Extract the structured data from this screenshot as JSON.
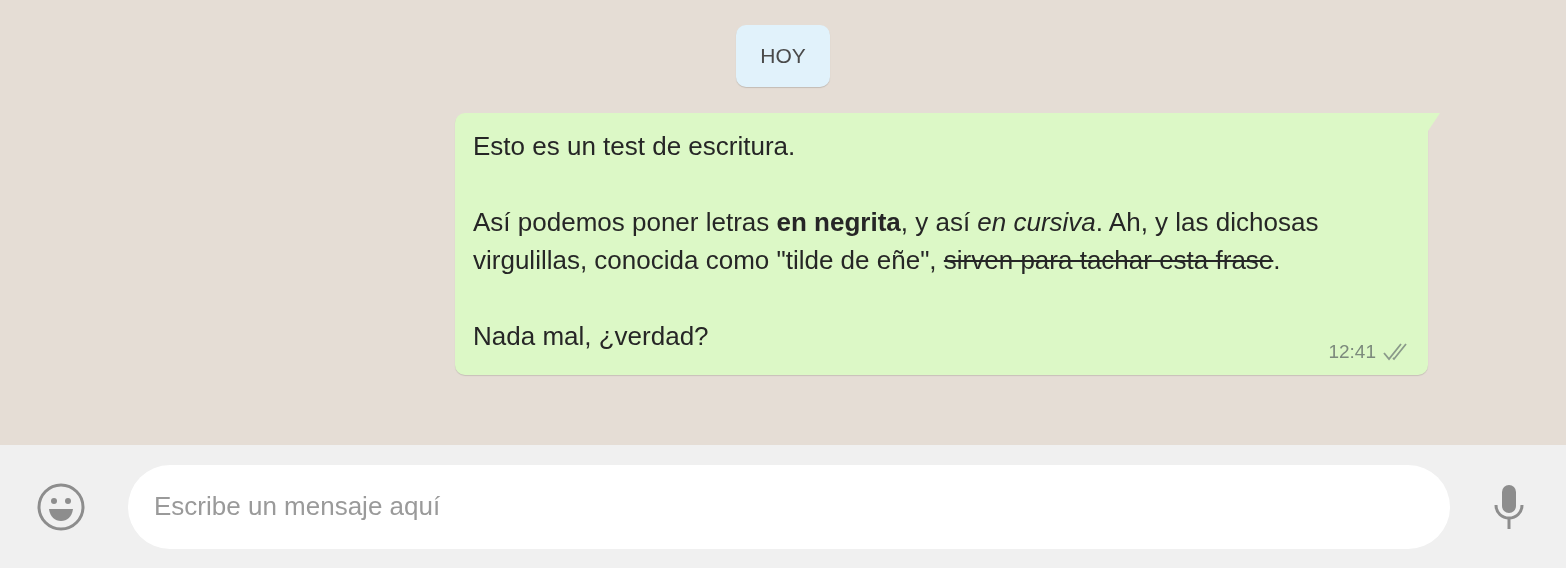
{
  "date_badge": "HOY",
  "message": {
    "paragraphs": [
      [
        {
          "kind": "normal",
          "text": "Esto es un test de escritura."
        }
      ],
      [
        {
          "kind": "normal",
          "text": "Así podemos poner letras "
        },
        {
          "kind": "bold",
          "text": "en negrita"
        },
        {
          "kind": "normal",
          "text": ", y así "
        },
        {
          "kind": "italic",
          "text": "en cursiva"
        },
        {
          "kind": "normal",
          "text": ". Ah, y las dichosas virgulillas, conocida como \"tilde de eñe\", "
        },
        {
          "kind": "strike",
          "text": "sirven para tachar esta frase"
        },
        {
          "kind": "normal",
          "text": "."
        }
      ],
      [
        {
          "kind": "normal",
          "text": "Nada mal, ¿verdad?"
        }
      ]
    ],
    "time": "12:41",
    "read": false
  },
  "composer": {
    "placeholder": "Escribe un mensaje aquí"
  }
}
